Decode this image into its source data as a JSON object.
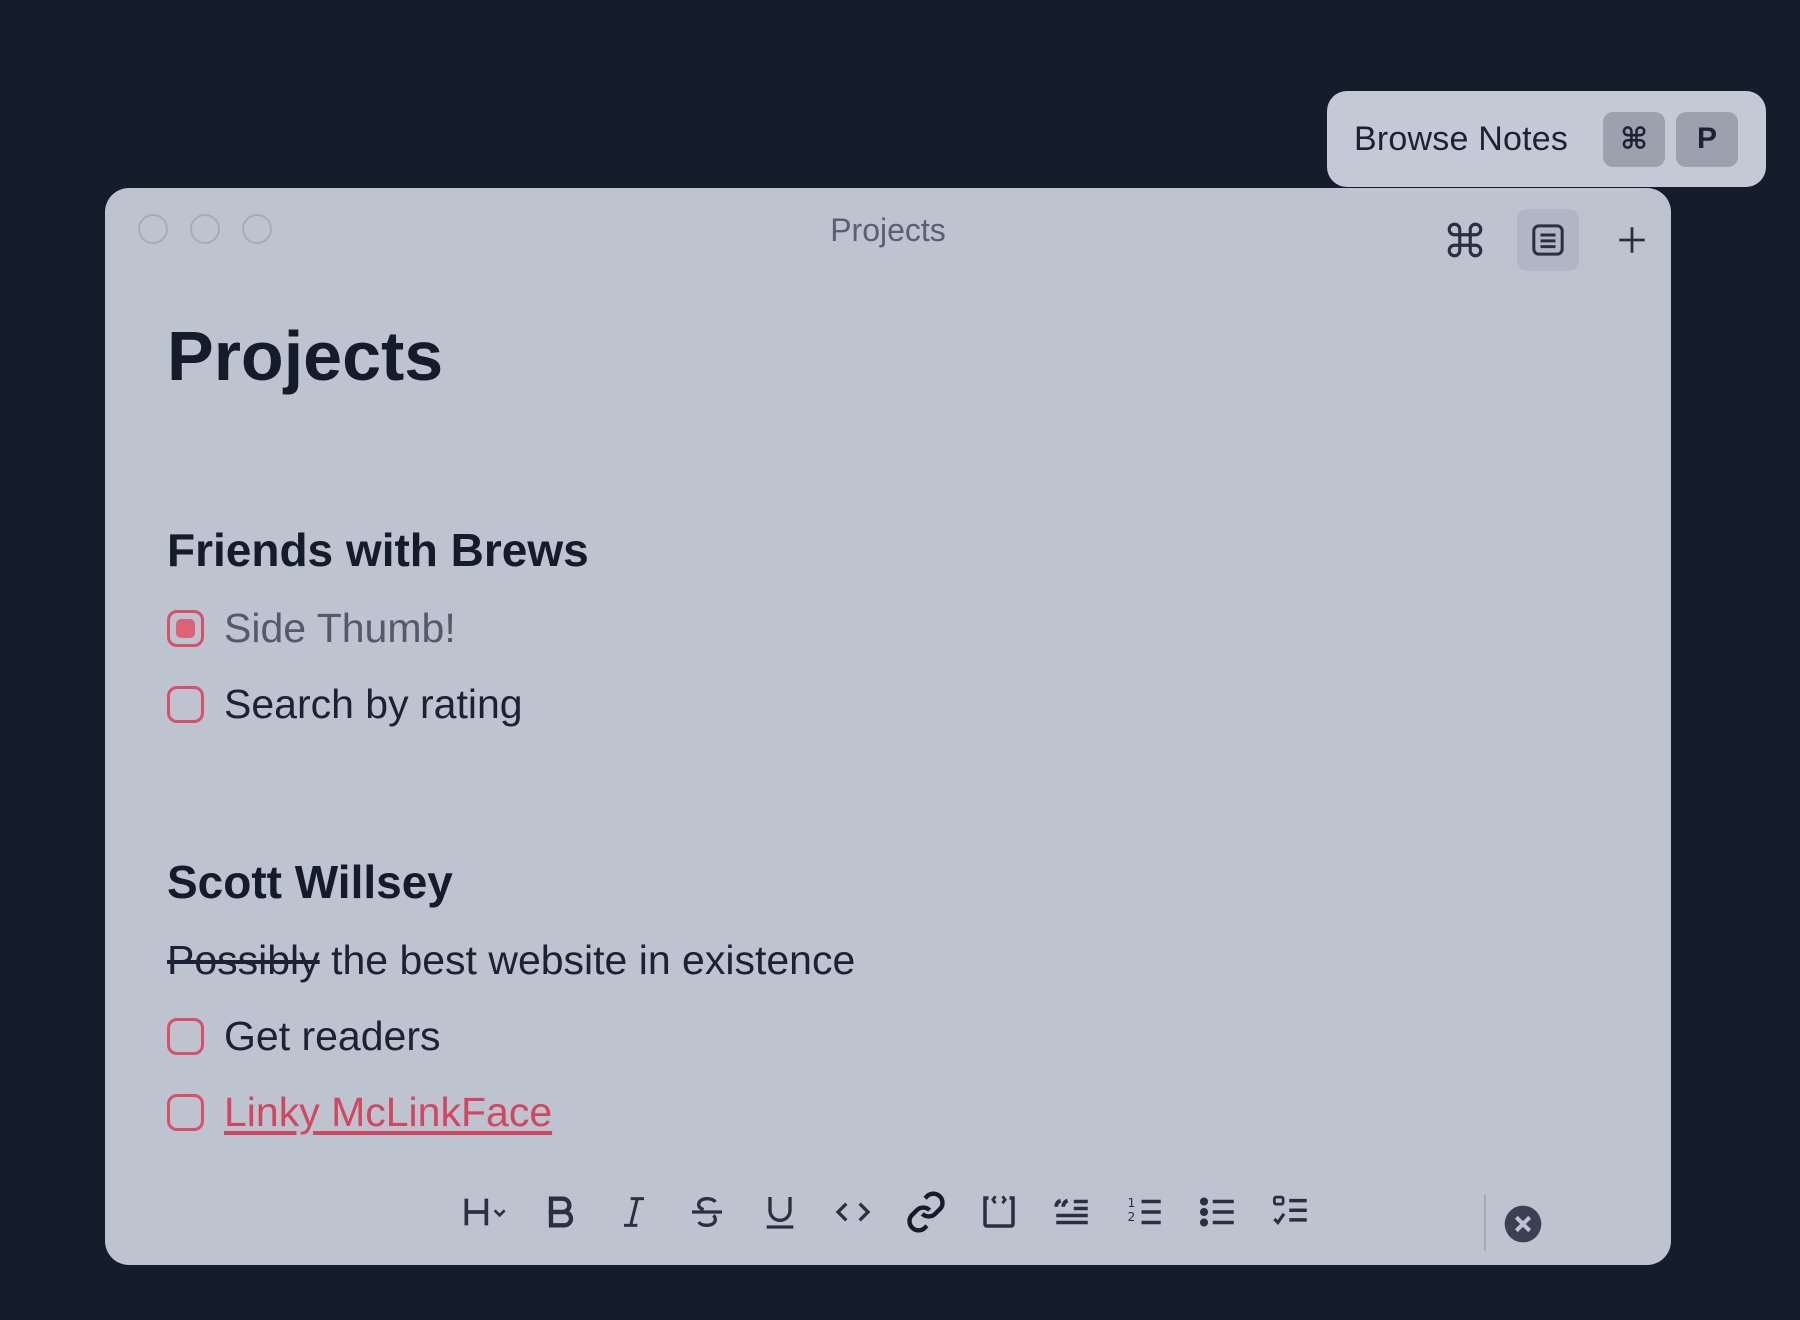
{
  "popover": {
    "label": "Browse Notes",
    "keys": [
      "⌘",
      "P"
    ]
  },
  "window": {
    "title": "Projects",
    "top_icons": [
      "command-icon",
      "note-list-icon",
      "plus-icon"
    ]
  },
  "note": {
    "title": "Projects",
    "sections": [
      {
        "heading": "Friends with Brews",
        "items": [
          {
            "type": "todo",
            "checked": true,
            "text": "Side Thumb!"
          },
          {
            "type": "todo",
            "checked": false,
            "text": "Search by rating"
          }
        ]
      },
      {
        "heading": "Scott Willsey",
        "paragraph": {
          "struck": "Possibly",
          "rest": " the best website in existence"
        },
        "items": [
          {
            "type": "todo",
            "checked": false,
            "text": "Get readers"
          },
          {
            "type": "todo",
            "checked": false,
            "text": "Linky McLinkFace",
            "link": true
          }
        ]
      }
    ]
  },
  "toolbar": {
    "tools": [
      "heading-icon",
      "bold-icon",
      "italic-icon",
      "strikethrough-icon",
      "underline-icon",
      "code-icon",
      "link-icon",
      "code-block-icon",
      "quote-icon",
      "numbered-list-icon",
      "bullet-list-icon",
      "checklist-icon"
    ],
    "close_icon": "close-circle-icon"
  },
  "colors": {
    "background": "#161d2a",
    "window": "#bec3d0",
    "accent": "#d8506a",
    "text": "#141b2b"
  }
}
